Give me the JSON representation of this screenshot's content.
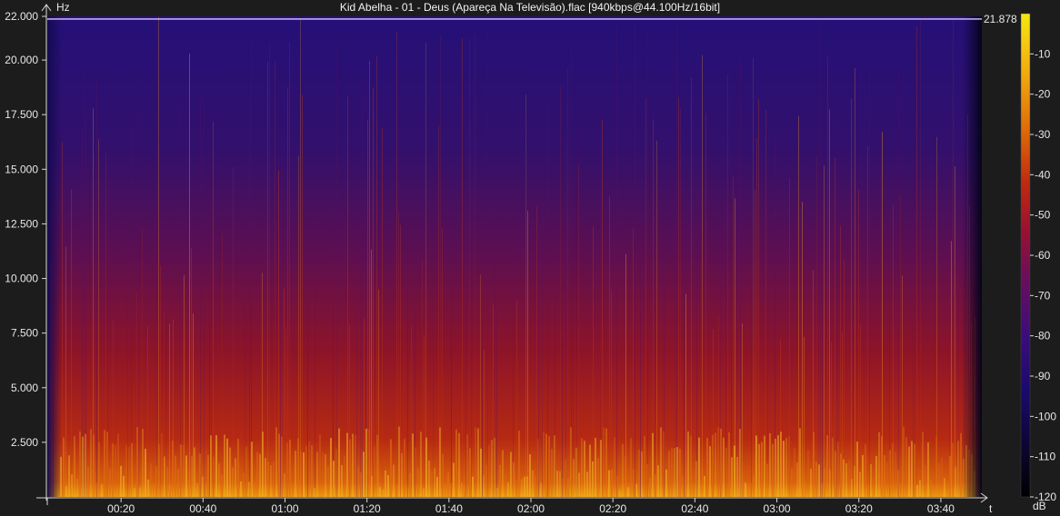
{
  "window_title": "Kid Abelha - 01 - Deus (Apareça Na Televisão).flac [940kbps@44.100Hz/16bit]",
  "chart_data": {
    "type": "heatmap",
    "title": "Kid Abelha - 01 - Deus (Apareça Na Televisão).flac [940kbps@44.100Hz/16bit]",
    "ylabel": "Hz",
    "xlabel": "t",
    "colorbar_label": "dB",
    "y_ticks": [
      "2.500",
      "5.000",
      "7.500",
      "10.000",
      "12.500",
      "15.000",
      "17.500",
      "20.000",
      "22.000"
    ],
    "y_tick_values": [
      2500,
      5000,
      7500,
      10000,
      12500,
      15000,
      17500,
      20000,
      22000
    ],
    "ylim": [
      0,
      22000
    ],
    "x_ticks": [
      "00:20",
      "00:40",
      "01:00",
      "01:20",
      "01:40",
      "02:00",
      "02:20",
      "02:40",
      "03:00",
      "03:20",
      "03:40"
    ],
    "x_tick_values_seconds": [
      20,
      40,
      60,
      80,
      100,
      120,
      140,
      160,
      180,
      200,
      220
    ],
    "cutoff_marker_label": "21.878",
    "cutoff_marker_hz": 21878,
    "colorbar_ticks": [
      "-10",
      "-20",
      "-30",
      "-40",
      "-50",
      "-60",
      "-70",
      "-80",
      "-90",
      "-100",
      "-110",
      "-120"
    ],
    "colorbar_tick_values": [
      -10,
      -20,
      -30,
      -40,
      -50,
      -60,
      -70,
      -80,
      -90,
      -100,
      -110,
      -120
    ],
    "colorbar_range_db": [
      -120,
      0
    ],
    "colormap": [
      "#000000",
      "#0b0630",
      "#1a0a6e",
      "#3a0d7c",
      "#6a0e5e",
      "#9a1030",
      "#c02a10",
      "#de6c08",
      "#f2ac10",
      "#f5e812"
    ]
  }
}
